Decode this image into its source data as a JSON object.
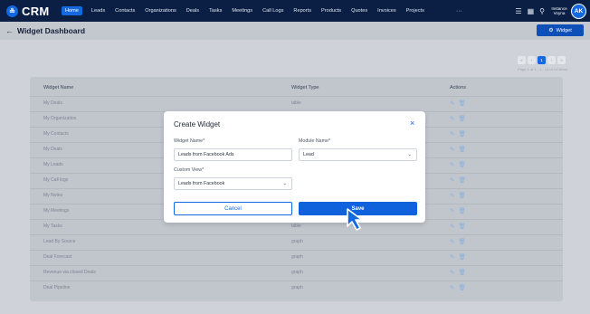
{
  "nav": {
    "logo_text": "CRM",
    "logo_glyph": "≗",
    "items": [
      {
        "label": "Home",
        "active": true
      },
      {
        "label": "Leads"
      },
      {
        "label": "Contacts"
      },
      {
        "label": "Organizations"
      },
      {
        "label": "Deals"
      },
      {
        "label": "Tasks"
      },
      {
        "label": "Meetings"
      },
      {
        "label": "Call Logs"
      },
      {
        "label": "Reports"
      },
      {
        "label": "Products"
      },
      {
        "label": "Quotes"
      },
      {
        "label": "Invoices"
      },
      {
        "label": "Projects"
      }
    ],
    "more": "···",
    "user_name": "Instance Voyna",
    "user_initials": "AK"
  },
  "subheader": {
    "title": "Widget Dashboard",
    "widget_button": "Widget"
  },
  "pagination": {
    "current": "1",
    "info": "Page 1 of 1 - 1 - 14 of 14 items"
  },
  "table": {
    "headers": [
      "Widget Name",
      "Widget Type",
      "Actions"
    ],
    "rows": [
      {
        "name": "My Deals",
        "type": "table"
      },
      {
        "name": "My Organization",
        "type": "table"
      },
      {
        "name": "My Contacts",
        "type": "table"
      },
      {
        "name": "My Deals",
        "type": "table"
      },
      {
        "name": "My Leads",
        "type": "table"
      },
      {
        "name": "My Call logs",
        "type": "table"
      },
      {
        "name": "My Notes",
        "type": "table"
      },
      {
        "name": "My Meetings",
        "type": "table"
      },
      {
        "name": "My Tasks",
        "type": "table"
      },
      {
        "name": "Lead By Source",
        "type": "graph"
      },
      {
        "name": "Deal Forecast",
        "type": "graph"
      },
      {
        "name": "Revenue via closed Deals",
        "type": "graph"
      },
      {
        "name": "Deal Pipeline",
        "type": "graph"
      }
    ]
  },
  "modal": {
    "title": "Create Widget",
    "close": "×",
    "widget_name_label": "Widget Name*",
    "widget_name_value": "Leads from Facebook Ads",
    "module_name_label": "Module Name*",
    "module_name_value": "Lead",
    "custom_view_label": "Custom View*",
    "custom_view_value": "Leads from Facebook",
    "cancel": "Cancel",
    "save": "Save"
  }
}
